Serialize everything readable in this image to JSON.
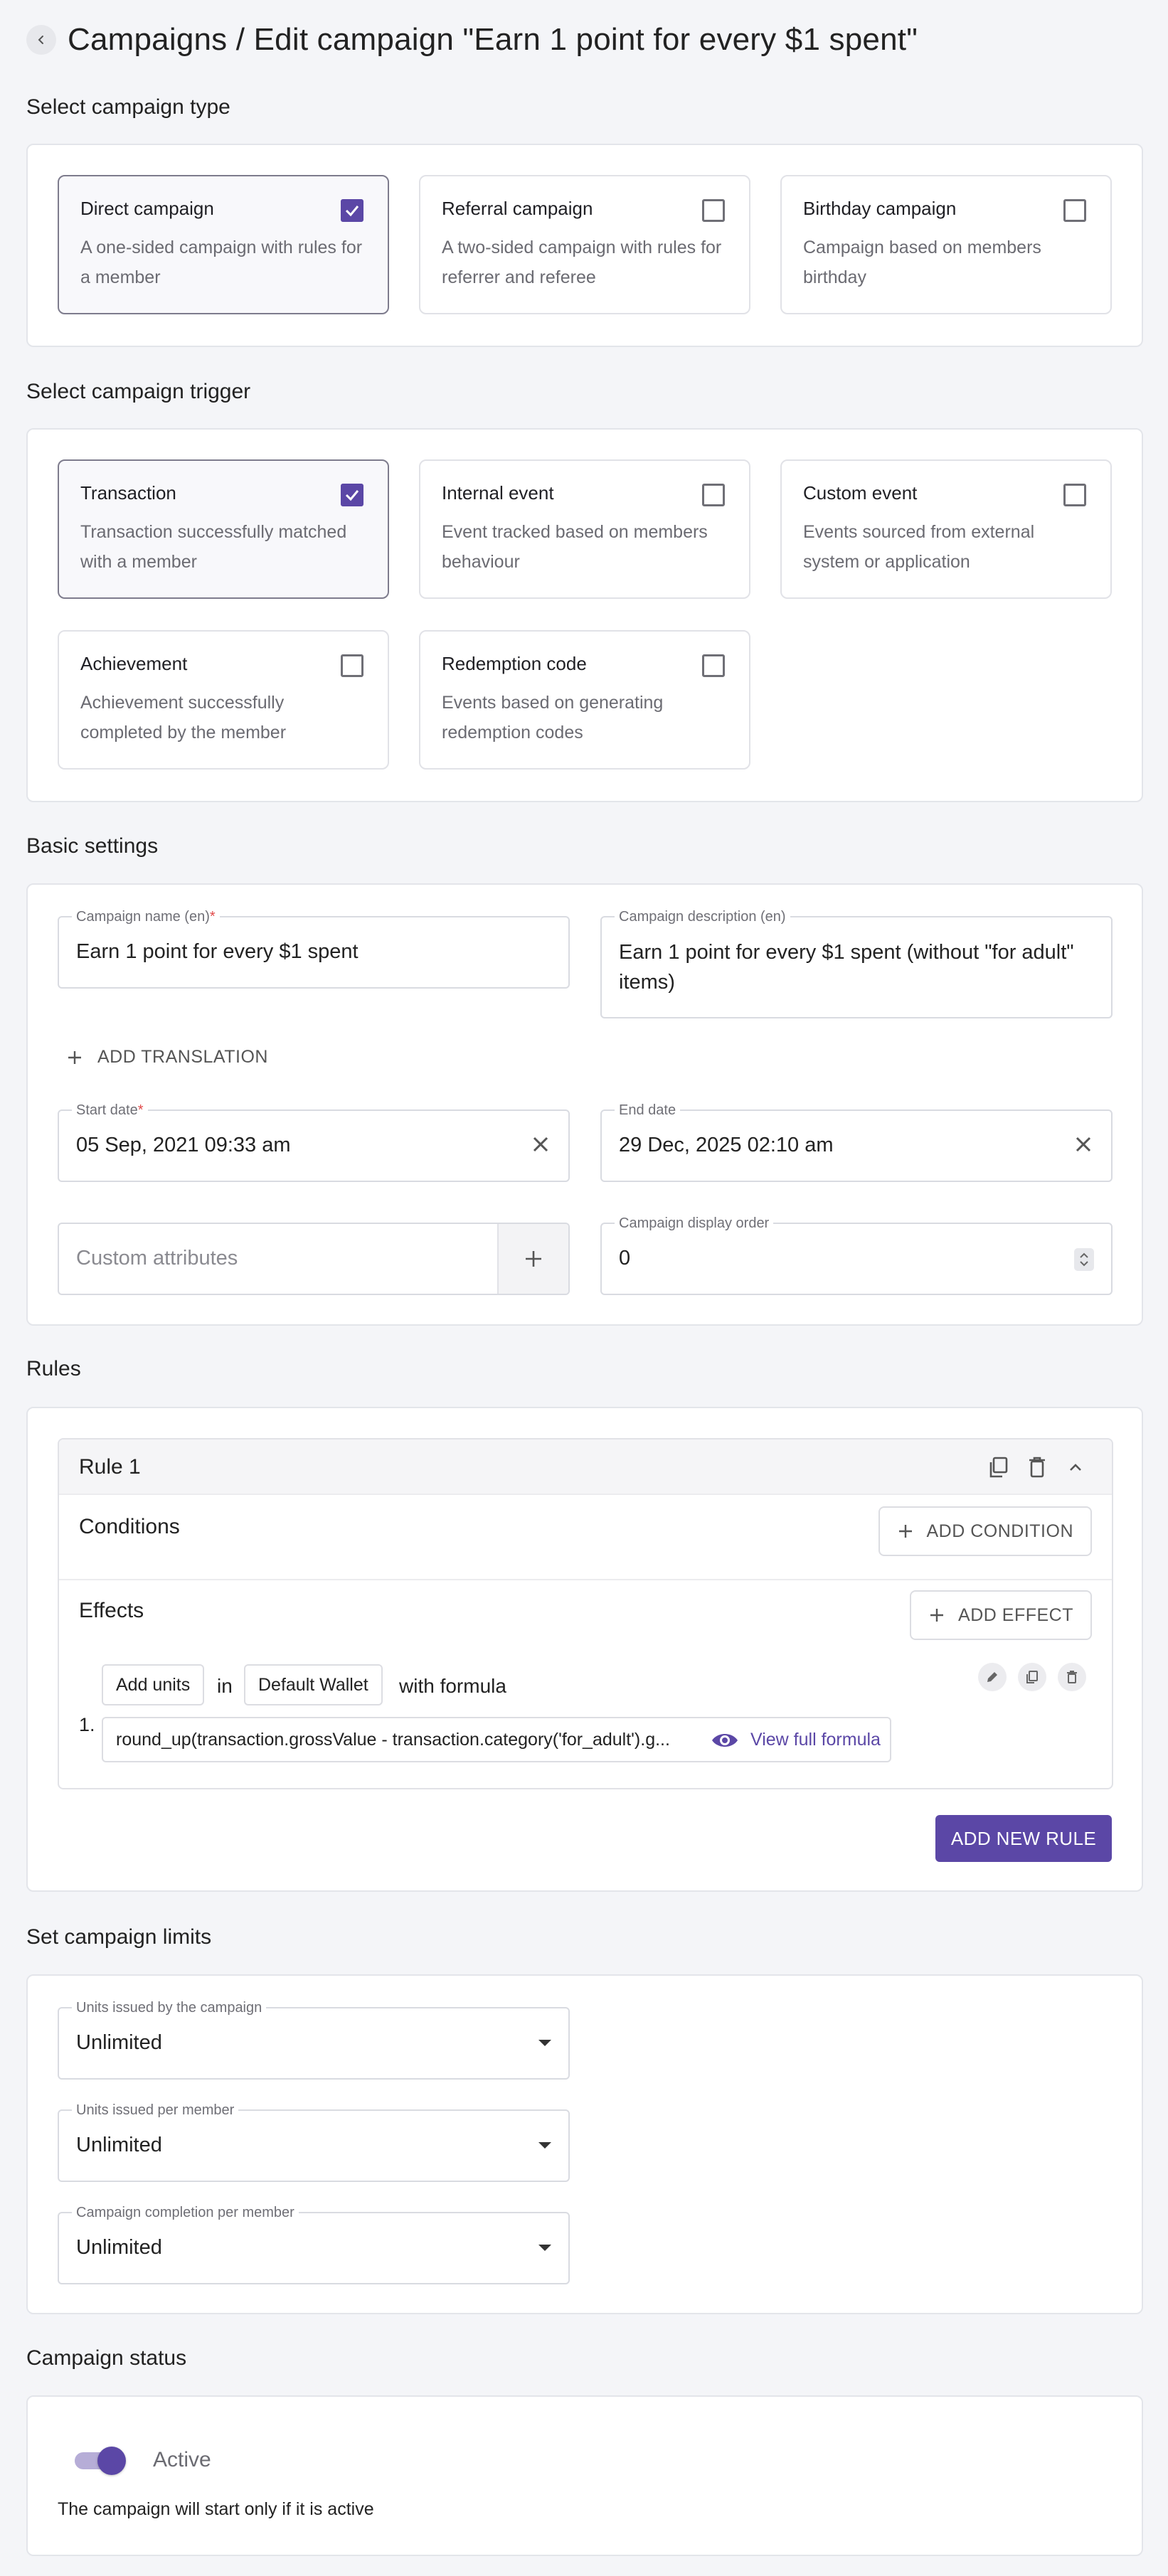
{
  "header": {
    "title": "Campaigns / Edit campaign \"Earn 1 point for every $1 spent\""
  },
  "campaign_type": {
    "section_title": "Select campaign type",
    "options": [
      {
        "title": "Direct campaign",
        "desc": "A one-sided campaign with rules for a member",
        "selected": true
      },
      {
        "title": "Referral campaign",
        "desc": "A two-sided campaign with rules for referrer and referee",
        "selected": false
      },
      {
        "title": "Birthday campaign",
        "desc": "Campaign based on members birthday",
        "selected": false
      }
    ]
  },
  "campaign_trigger": {
    "section_title": "Select campaign trigger",
    "options": [
      {
        "title": "Transaction",
        "desc": "Transaction successfully matched with a member",
        "selected": true
      },
      {
        "title": "Internal event",
        "desc": "Event tracked based on members behaviour",
        "selected": false
      },
      {
        "title": "Custom event",
        "desc": "Events sourced from external system or application",
        "selected": false
      },
      {
        "title": "Achievement",
        "desc": "Achievement successfully completed by the member",
        "selected": false
      },
      {
        "title": "Redemption code",
        "desc": "Events based on generating redemption codes",
        "selected": false
      }
    ]
  },
  "basic_settings": {
    "section_title": "Basic settings",
    "campaign_name_label": "Campaign name (en)",
    "campaign_name_value": "Earn 1 point for every $1 spent",
    "campaign_desc_label": "Campaign description (en)",
    "campaign_desc_value": "Earn 1 point for every $1 spent (without \"for adult\" items)",
    "add_translation": "ADD TRANSLATION",
    "start_date_label": "Start date",
    "start_date_value": "05 Sep, 2021 09:33 am",
    "end_date_label": "End date",
    "end_date_value": "29 Dec, 2025 02:10 am",
    "custom_attributes_placeholder": "Custom attributes",
    "display_order_label": "Campaign display order",
    "display_order_value": "0",
    "required_mark": "*"
  },
  "rules": {
    "section_title": "Rules",
    "rule_title": "Rule 1",
    "conditions_label": "Conditions",
    "add_condition": "ADD CONDITION",
    "effects_label": "Effects",
    "add_effect": "ADD EFFECT",
    "effect_index": "1.",
    "effect_action": "Add units",
    "effect_in": "in",
    "effect_wallet": "Default Wallet",
    "effect_with_formula": "with formula",
    "formula": "round_up(transaction.grossValue - transaction.category('for_adult').g...",
    "view_formula": "View full formula",
    "add_new_rule": "ADD NEW RULE"
  },
  "limits": {
    "section_title": "Set campaign limits",
    "fields": [
      {
        "label": "Units issued by the campaign",
        "value": "Unlimited"
      },
      {
        "label": "Units issued per member",
        "value": "Unlimited"
      },
      {
        "label": "Campaign completion per member",
        "value": "Unlimited"
      }
    ]
  },
  "status": {
    "section_title": "Campaign status",
    "toggle_label": "Active",
    "toggle_on": true,
    "note": "The campaign will start only if it is active"
  },
  "colors": {
    "accent": "#5b47a6",
    "required": "#e14a4a",
    "link": "#5b47a6"
  }
}
